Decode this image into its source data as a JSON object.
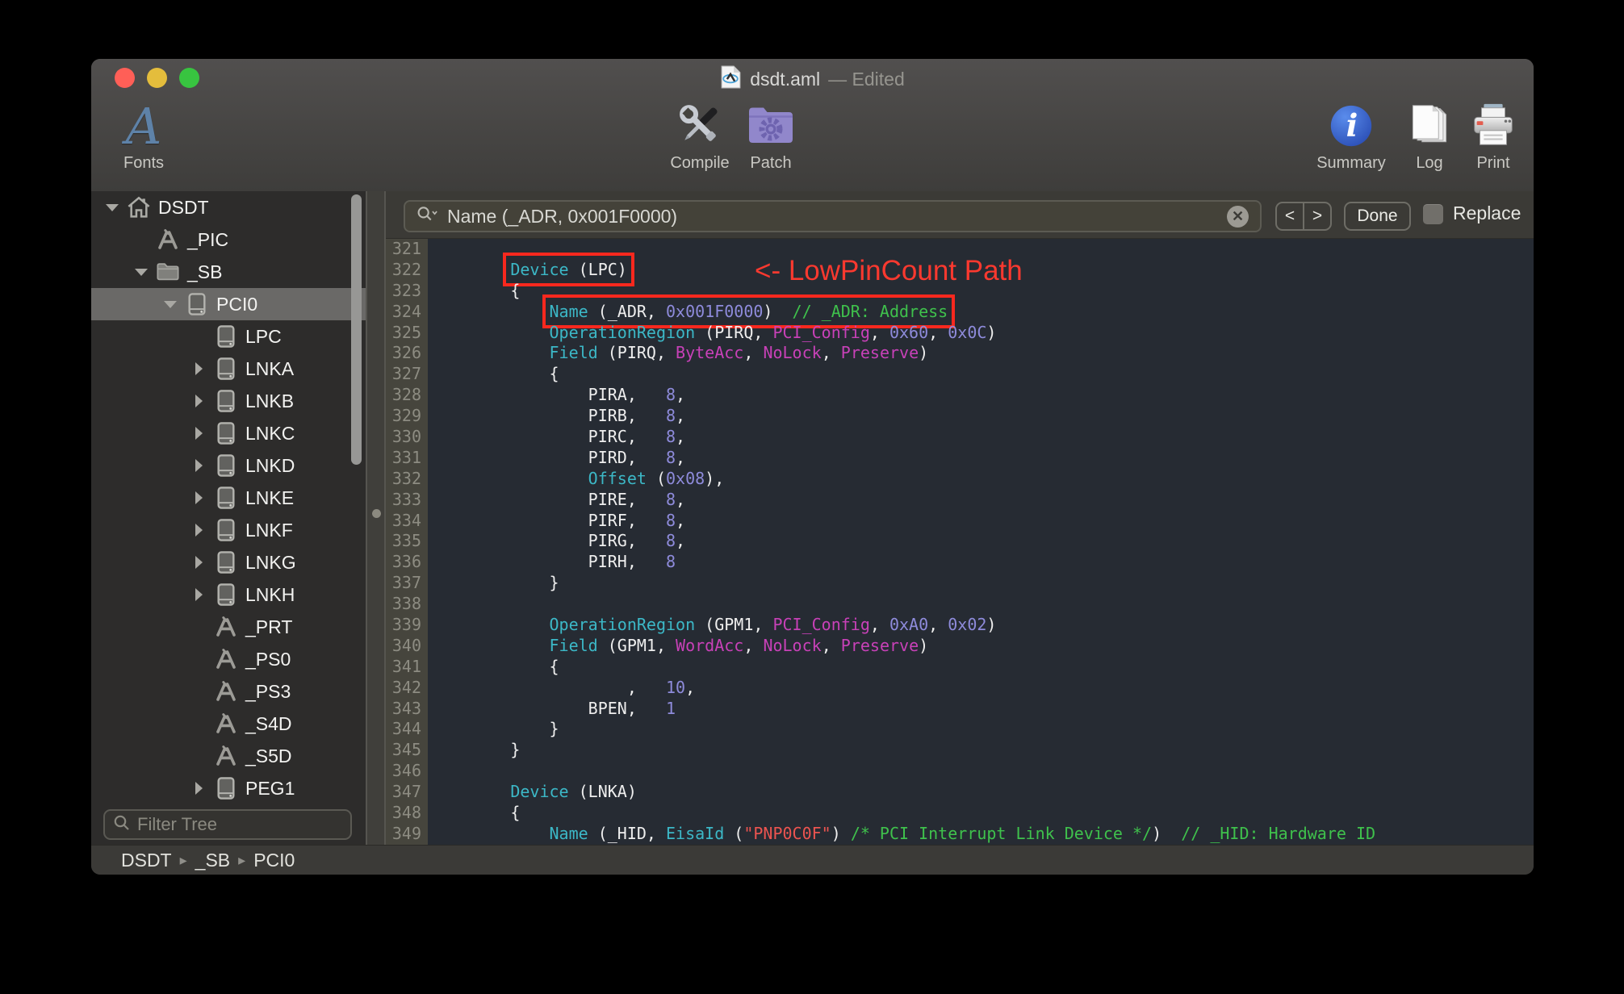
{
  "window": {
    "title": "dsdt.aml",
    "title_suffix": "— Edited"
  },
  "toolbar": {
    "fonts_label": "Fonts",
    "compile_label": "Compile",
    "patch_label": "Patch",
    "summary_label": "Summary",
    "log_label": "Log",
    "print_label": "Print"
  },
  "search": {
    "query": "Name (_ADR, 0x001F0000)",
    "prev_label": "<",
    "next_label": ">",
    "done_label": "Done",
    "replace_label": "Replace"
  },
  "sidebar": {
    "filter_placeholder": "Filter Tree",
    "tree": [
      {
        "label": "DSDT",
        "icon": "home",
        "depth": 0,
        "disc": "open",
        "selected": false
      },
      {
        "label": "_PIC",
        "icon": "method",
        "depth": 1,
        "disc": "none",
        "selected": false
      },
      {
        "label": "_SB",
        "icon": "folder",
        "depth": 1,
        "disc": "open",
        "selected": false
      },
      {
        "label": "PCI0",
        "icon": "device",
        "depth": 2,
        "disc": "open",
        "selected": true
      },
      {
        "label": "LPC",
        "icon": "device",
        "depth": 3,
        "disc": "none",
        "selected": false
      },
      {
        "label": "LNKA",
        "icon": "device",
        "depth": 3,
        "disc": "closed",
        "selected": false
      },
      {
        "label": "LNKB",
        "icon": "device",
        "depth": 3,
        "disc": "closed",
        "selected": false
      },
      {
        "label": "LNKC",
        "icon": "device",
        "depth": 3,
        "disc": "closed",
        "selected": false
      },
      {
        "label": "LNKD",
        "icon": "device",
        "depth": 3,
        "disc": "closed",
        "selected": false
      },
      {
        "label": "LNKE",
        "icon": "device",
        "depth": 3,
        "disc": "closed",
        "selected": false
      },
      {
        "label": "LNKF",
        "icon": "device",
        "depth": 3,
        "disc": "closed",
        "selected": false
      },
      {
        "label": "LNKG",
        "icon": "device",
        "depth": 3,
        "disc": "closed",
        "selected": false
      },
      {
        "label": "LNKH",
        "icon": "device",
        "depth": 3,
        "disc": "closed",
        "selected": false
      },
      {
        "label": "_PRT",
        "icon": "method",
        "depth": 3,
        "disc": "none",
        "selected": false
      },
      {
        "label": "_PS0",
        "icon": "method",
        "depth": 3,
        "disc": "none",
        "selected": false
      },
      {
        "label": "_PS3",
        "icon": "method",
        "depth": 3,
        "disc": "none",
        "selected": false
      },
      {
        "label": "_S4D",
        "icon": "method",
        "depth": 3,
        "disc": "none",
        "selected": false
      },
      {
        "label": "_S5D",
        "icon": "method",
        "depth": 3,
        "disc": "none",
        "selected": false
      },
      {
        "label": "PEG1",
        "icon": "device",
        "depth": 3,
        "disc": "closed",
        "selected": false
      }
    ]
  },
  "statusbar": {
    "breadcrumb": [
      "DSDT",
      "_SB",
      "PCI0"
    ],
    "separator": "▸"
  },
  "editor": {
    "annotation_color": "#fb392f",
    "box_color": "#f8281e",
    "token_colors": {
      "keyword": "#3cb8c7",
      "plain": "#eeeeee",
      "number": "#8e8bdb",
      "predefined": "#c841b8",
      "comment": "#3fc14c",
      "string": "#ec5450"
    },
    "lines": [
      {
        "n": 321,
        "toks": []
      },
      {
        "n": 322,
        "toks": [
          [
            "p",
            "        "
          ],
          [
            "k",
            "Device"
          ],
          [
            "p",
            " (LPC)"
          ]
        ],
        "box": [
          1,
          2
        ],
        "annot": "<- LowPinCount Path"
      },
      {
        "n": 323,
        "toks": [
          [
            "p",
            "        {"
          ]
        ]
      },
      {
        "n": 324,
        "toks": [
          [
            "p",
            "            "
          ],
          [
            "k",
            "Name"
          ],
          [
            "p",
            " (_ADR, "
          ],
          [
            "n",
            "0x001F0000"
          ],
          [
            "p",
            ")  "
          ],
          [
            "c",
            "// _ADR: Address"
          ]
        ],
        "box": [
          1,
          5
        ]
      },
      {
        "n": 325,
        "toks": [
          [
            "p",
            "            "
          ],
          [
            "k",
            "OperationRegion"
          ],
          [
            "p",
            " (PIRQ, "
          ],
          [
            "m",
            "PCI_Config"
          ],
          [
            "p",
            ", "
          ],
          [
            "n",
            "0x60"
          ],
          [
            "p",
            ", "
          ],
          [
            "n",
            "0x0C"
          ],
          [
            "p",
            ")"
          ]
        ]
      },
      {
        "n": 326,
        "toks": [
          [
            "p",
            "            "
          ],
          [
            "k",
            "Field"
          ],
          [
            "p",
            " (PIRQ, "
          ],
          [
            "m",
            "ByteAcc"
          ],
          [
            "p",
            ", "
          ],
          [
            "m",
            "NoLock"
          ],
          [
            "p",
            ", "
          ],
          [
            "m",
            "Preserve"
          ],
          [
            "p",
            ")"
          ]
        ]
      },
      {
        "n": 327,
        "toks": [
          [
            "p",
            "            {"
          ]
        ]
      },
      {
        "n": 328,
        "toks": [
          [
            "p",
            "                PIRA,   "
          ],
          [
            "n",
            "8"
          ],
          [
            "p",
            ","
          ]
        ]
      },
      {
        "n": 329,
        "toks": [
          [
            "p",
            "                PIRB,   "
          ],
          [
            "n",
            "8"
          ],
          [
            "p",
            ","
          ]
        ]
      },
      {
        "n": 330,
        "toks": [
          [
            "p",
            "                PIRC,   "
          ],
          [
            "n",
            "8"
          ],
          [
            "p",
            ","
          ]
        ]
      },
      {
        "n": 331,
        "toks": [
          [
            "p",
            "                PIRD,   "
          ],
          [
            "n",
            "8"
          ],
          [
            "p",
            ","
          ]
        ]
      },
      {
        "n": 332,
        "toks": [
          [
            "p",
            "                "
          ],
          [
            "k",
            "Offset"
          ],
          [
            "p",
            " ("
          ],
          [
            "n",
            "0x08"
          ],
          [
            "p",
            "),"
          ]
        ]
      },
      {
        "n": 333,
        "toks": [
          [
            "p",
            "                PIRE,   "
          ],
          [
            "n",
            "8"
          ],
          [
            "p",
            ","
          ]
        ]
      },
      {
        "n": 334,
        "toks": [
          [
            "p",
            "                PIRF,   "
          ],
          [
            "n",
            "8"
          ],
          [
            "p",
            ","
          ]
        ]
      },
      {
        "n": 335,
        "toks": [
          [
            "p",
            "                PIRG,   "
          ],
          [
            "n",
            "8"
          ],
          [
            "p",
            ","
          ]
        ]
      },
      {
        "n": 336,
        "toks": [
          [
            "p",
            "                PIRH,   "
          ],
          [
            "n",
            "8"
          ]
        ]
      },
      {
        "n": 337,
        "toks": [
          [
            "p",
            "            }"
          ]
        ]
      },
      {
        "n": 338,
        "toks": []
      },
      {
        "n": 339,
        "toks": [
          [
            "p",
            "            "
          ],
          [
            "k",
            "OperationRegion"
          ],
          [
            "p",
            " (GPM1, "
          ],
          [
            "m",
            "PCI_Config"
          ],
          [
            "p",
            ", "
          ],
          [
            "n",
            "0xA0"
          ],
          [
            "p",
            ", "
          ],
          [
            "n",
            "0x02"
          ],
          [
            "p",
            ")"
          ]
        ]
      },
      {
        "n": 340,
        "toks": [
          [
            "p",
            "            "
          ],
          [
            "k",
            "Field"
          ],
          [
            "p",
            " (GPM1, "
          ],
          [
            "m",
            "WordAcc"
          ],
          [
            "p",
            ", "
          ],
          [
            "m",
            "NoLock"
          ],
          [
            "p",
            ", "
          ],
          [
            "m",
            "Preserve"
          ],
          [
            "p",
            ")"
          ]
        ]
      },
      {
        "n": 341,
        "toks": [
          [
            "p",
            "            {"
          ]
        ]
      },
      {
        "n": 342,
        "toks": [
          [
            "p",
            "                    ,   "
          ],
          [
            "n",
            "10"
          ],
          [
            "p",
            ","
          ]
        ]
      },
      {
        "n": 343,
        "toks": [
          [
            "p",
            "                BPEN,   "
          ],
          [
            "n",
            "1"
          ]
        ]
      },
      {
        "n": 344,
        "toks": [
          [
            "p",
            "            }"
          ]
        ]
      },
      {
        "n": 345,
        "toks": [
          [
            "p",
            "        }"
          ]
        ]
      },
      {
        "n": 346,
        "toks": []
      },
      {
        "n": 347,
        "toks": [
          [
            "p",
            "        "
          ],
          [
            "k",
            "Device"
          ],
          [
            "p",
            " (LNKA)"
          ]
        ]
      },
      {
        "n": 348,
        "toks": [
          [
            "p",
            "        {"
          ]
        ]
      },
      {
        "n": 349,
        "toks": [
          [
            "p",
            "            "
          ],
          [
            "k",
            "Name"
          ],
          [
            "p",
            " (_HID, "
          ],
          [
            "k",
            "EisaId"
          ],
          [
            "p",
            " ("
          ],
          [
            "s",
            "\"PNP0C0F\""
          ],
          [
            "p",
            ") "
          ],
          [
            "c",
            "/* PCI Interrupt Link Device */"
          ],
          [
            "p",
            ")  "
          ],
          [
            "c",
            "// _HID: Hardware ID"
          ]
        ]
      }
    ]
  }
}
